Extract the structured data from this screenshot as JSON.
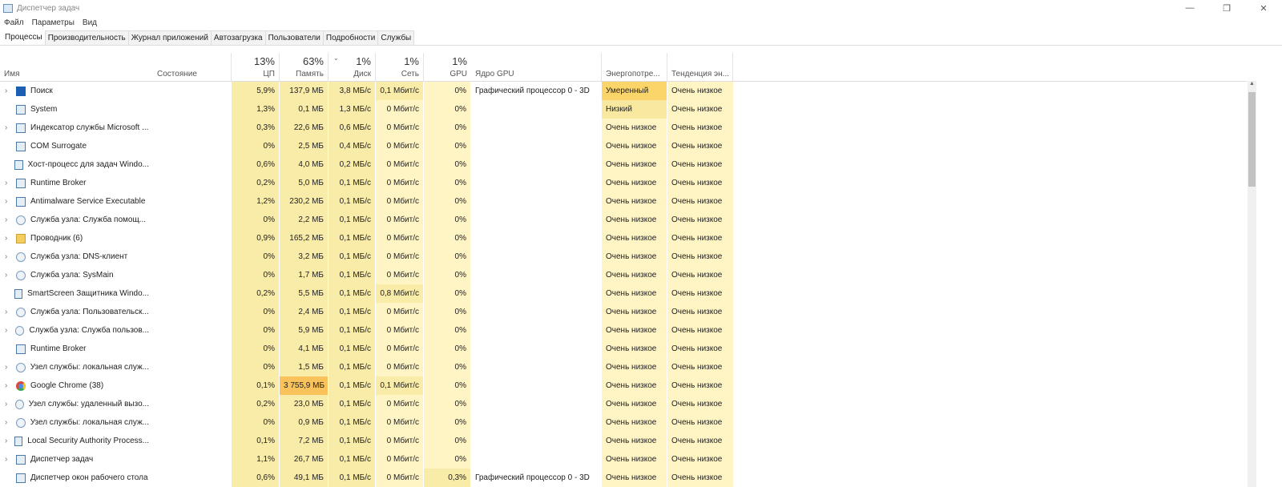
{
  "window": {
    "title": "Диспетчер задач"
  },
  "menu": [
    "Файл",
    "Параметры",
    "Вид"
  ],
  "tabs": [
    "Процессы",
    "Производительность",
    "Журнал приложений",
    "Автозагрузка",
    "Пользователи",
    "Подробности",
    "Службы"
  ],
  "columns": {
    "name": "Имя",
    "state": "Состояние",
    "cpu_pct": "13%",
    "cpu": "ЦП",
    "mem_pct": "63%",
    "mem": "Память",
    "disk_pct": "1%",
    "disk": "Диск",
    "net_pct": "1%",
    "net": "Сеть",
    "gpu_pct": "1%",
    "gpu": "GPU",
    "gpu_engine": "Ядро GPU",
    "power": "Энергопотре...",
    "power_trend": "Тенденция эн..."
  },
  "rows": [
    {
      "name": "Поиск",
      "icon": "search",
      "exp": true,
      "cpu": "5,9%",
      "mem": "137,9 МБ",
      "disk": "3,8 МБ/с",
      "net": "0,1 Мбит/с",
      "gpu": "0%",
      "engine": "Графический процессор 0 - 3D",
      "power": "Умеренный",
      "trend": "Очень низкое"
    },
    {
      "name": "System",
      "icon": "app",
      "exp": false,
      "cpu": "1,3%",
      "mem": "0,1 МБ",
      "disk": "1,3 МБ/с",
      "net": "0 Мбит/с",
      "gpu": "0%",
      "engine": "",
      "power": "Низкий",
      "trend": "Очень низкое"
    },
    {
      "name": "Индексатор службы Microsoft ...",
      "icon": "user",
      "exp": true,
      "cpu": "0,3%",
      "mem": "22,6 МБ",
      "disk": "0,6 МБ/с",
      "net": "0 Мбит/с",
      "gpu": "0%",
      "engine": "",
      "power": "Очень низкое",
      "trend": "Очень низкое"
    },
    {
      "name": "COM Surrogate",
      "icon": "app",
      "exp": false,
      "cpu": "0%",
      "mem": "2,5 МБ",
      "disk": "0,4 МБ/с",
      "net": "0 Мбит/с",
      "gpu": "0%",
      "engine": "",
      "power": "Очень низкое",
      "trend": "Очень низкое"
    },
    {
      "name": "Хост-процесс для задач Windo...",
      "icon": "app",
      "exp": false,
      "cpu": "0,6%",
      "mem": "4,0 МБ",
      "disk": "0,2 МБ/с",
      "net": "0 Мбит/с",
      "gpu": "0%",
      "engine": "",
      "power": "Очень низкое",
      "trend": "Очень низкое"
    },
    {
      "name": "Runtime Broker",
      "icon": "app",
      "exp": true,
      "cpu": "0,2%",
      "mem": "5,0 МБ",
      "disk": "0,1 МБ/с",
      "net": "0 Мбит/с",
      "gpu": "0%",
      "engine": "",
      "power": "Очень низкое",
      "trend": "Очень низкое"
    },
    {
      "name": "Antimalware Service Executable",
      "icon": "app",
      "exp": true,
      "cpu": "1,2%",
      "mem": "230,2 МБ",
      "disk": "0,1 МБ/с",
      "net": "0 Мбит/с",
      "gpu": "0%",
      "engine": "",
      "power": "Очень низкое",
      "trend": "Очень низкое"
    },
    {
      "name": "Служба узла: Служба помощ...",
      "icon": "gear",
      "exp": true,
      "cpu": "0%",
      "mem": "2,2 МБ",
      "disk": "0,1 МБ/с",
      "net": "0 Мбит/с",
      "gpu": "0%",
      "engine": "",
      "power": "Очень низкое",
      "trend": "Очень низкое"
    },
    {
      "name": "Проводник (6)",
      "icon": "folder",
      "exp": true,
      "cpu": "0,9%",
      "mem": "165,2 МБ",
      "disk": "0,1 МБ/с",
      "net": "0 Мбит/с",
      "gpu": "0%",
      "engine": "",
      "power": "Очень низкое",
      "trend": "Очень низкое"
    },
    {
      "name": "Служба узла: DNS-клиент",
      "icon": "gear",
      "exp": true,
      "cpu": "0%",
      "mem": "3,2 МБ",
      "disk": "0,1 МБ/с",
      "net": "0 Мбит/с",
      "gpu": "0%",
      "engine": "",
      "power": "Очень низкое",
      "trend": "Очень низкое"
    },
    {
      "name": "Служба узла: SysMain",
      "icon": "gear",
      "exp": true,
      "cpu": "0%",
      "mem": "1,7 МБ",
      "disk": "0,1 МБ/с",
      "net": "0 Мбит/с",
      "gpu": "0%",
      "engine": "",
      "power": "Очень низкое",
      "trend": "Очень низкое"
    },
    {
      "name": "SmartScreen Защитника Windo...",
      "icon": "app",
      "exp": false,
      "cpu": "0,2%",
      "mem": "5,5 МБ",
      "disk": "0,1 МБ/с",
      "net": "0,8 Мбит/с",
      "gpu": "0%",
      "engine": "",
      "power": "Очень низкое",
      "trend": "Очень низкое"
    },
    {
      "name": "Служба узла: Пользовательск...",
      "icon": "gear",
      "exp": true,
      "cpu": "0%",
      "mem": "2,4 МБ",
      "disk": "0,1 МБ/с",
      "net": "0 Мбит/с",
      "gpu": "0%",
      "engine": "",
      "power": "Очень низкое",
      "trend": "Очень низкое"
    },
    {
      "name": "Служба узла: Служба пользов...",
      "icon": "gear",
      "exp": true,
      "cpu": "0%",
      "mem": "5,9 МБ",
      "disk": "0,1 МБ/с",
      "net": "0 Мбит/с",
      "gpu": "0%",
      "engine": "",
      "power": "Очень низкое",
      "trend": "Очень низкое"
    },
    {
      "name": "Runtime Broker",
      "icon": "app",
      "exp": false,
      "cpu": "0%",
      "mem": "4,1 МБ",
      "disk": "0,1 МБ/с",
      "net": "0 Мбит/с",
      "gpu": "0%",
      "engine": "",
      "power": "Очень низкое",
      "trend": "Очень низкое"
    },
    {
      "name": "Узел службы: локальная служ...",
      "icon": "gear",
      "exp": true,
      "cpu": "0%",
      "mem": "1,5 МБ",
      "disk": "0,1 МБ/с",
      "net": "0 Мбит/с",
      "gpu": "0%",
      "engine": "",
      "power": "Очень низкое",
      "trend": "Очень низкое"
    },
    {
      "name": "Google Chrome (38)",
      "icon": "chrome",
      "exp": true,
      "cpu": "0,1%",
      "mem": "3 755,9 МБ",
      "disk": "0,1 МБ/с",
      "net": "0,1 Мбит/с",
      "gpu": "0%",
      "engine": "",
      "power": "Очень низкое",
      "trend": "Очень низкое"
    },
    {
      "name": "Узел службы: удаленный вызо...",
      "icon": "gear",
      "exp": true,
      "cpu": "0,2%",
      "mem": "23,0 МБ",
      "disk": "0,1 МБ/с",
      "net": "0 Мбит/с",
      "gpu": "0%",
      "engine": "",
      "power": "Очень низкое",
      "trend": "Очень низкое"
    },
    {
      "name": "Узел службы: локальная служ...",
      "icon": "gear",
      "exp": true,
      "cpu": "0%",
      "mem": "0,9 МБ",
      "disk": "0,1 МБ/с",
      "net": "0 Мбит/с",
      "gpu": "0%",
      "engine": "",
      "power": "Очень низкое",
      "trend": "Очень низкое"
    },
    {
      "name": "Local Security Authority Process...",
      "icon": "app",
      "exp": true,
      "cpu": "0,1%",
      "mem": "7,2 МБ",
      "disk": "0,1 МБ/с",
      "net": "0 Мбит/с",
      "gpu": "0%",
      "engine": "",
      "power": "Очень низкое",
      "trend": "Очень низкое"
    },
    {
      "name": "Диспетчер задач",
      "icon": "app",
      "exp": true,
      "cpu": "1,1%",
      "mem": "26,7 МБ",
      "disk": "0,1 МБ/с",
      "net": "0 Мбит/с",
      "gpu": "0%",
      "engine": "",
      "power": "Очень низкое",
      "trend": "Очень низкое"
    },
    {
      "name": "Диспетчер окон рабочего стола",
      "icon": "app",
      "exp": false,
      "cpu": "0,6%",
      "mem": "49,1 МБ",
      "disk": "0,1 МБ/с",
      "net": "0 Мбит/с",
      "gpu": "0,3%",
      "engine": "Графический процессор 0 - 3D",
      "power": "Очень низкое",
      "trend": "Очень низкое"
    }
  ]
}
